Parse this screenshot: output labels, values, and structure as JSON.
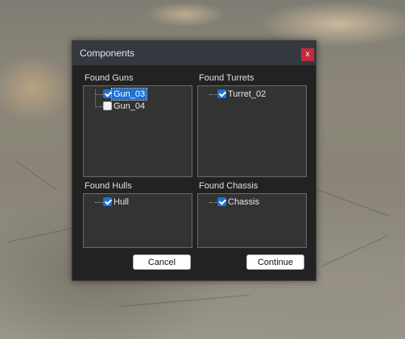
{
  "dialog": {
    "title": "Components",
    "close_label": "x"
  },
  "groups": {
    "guns": {
      "label": "Found Guns",
      "items": [
        {
          "label": "Gun_03",
          "checked": true,
          "selected": true
        },
        {
          "label": "Gun_04",
          "checked": false,
          "selected": false
        }
      ]
    },
    "turrets": {
      "label": "Found Turrets",
      "items": [
        {
          "label": "Turret_02",
          "checked": true,
          "selected": false
        }
      ]
    },
    "hulls": {
      "label": "Found Hulls",
      "items": [
        {
          "label": "Hull",
          "checked": true,
          "selected": false
        }
      ]
    },
    "chassis": {
      "label": "Found Chassis",
      "items": [
        {
          "label": "Chassis",
          "checked": true,
          "selected": false
        }
      ]
    }
  },
  "buttons": {
    "cancel_label": "Cancel",
    "continue_label": "Continue"
  },
  "colors": {
    "accent": "#1b72d6",
    "close": "#c42b3b",
    "dialog_bg": "#222222",
    "titlebar_bg": "#33393f",
    "tree_bg": "#333333"
  }
}
